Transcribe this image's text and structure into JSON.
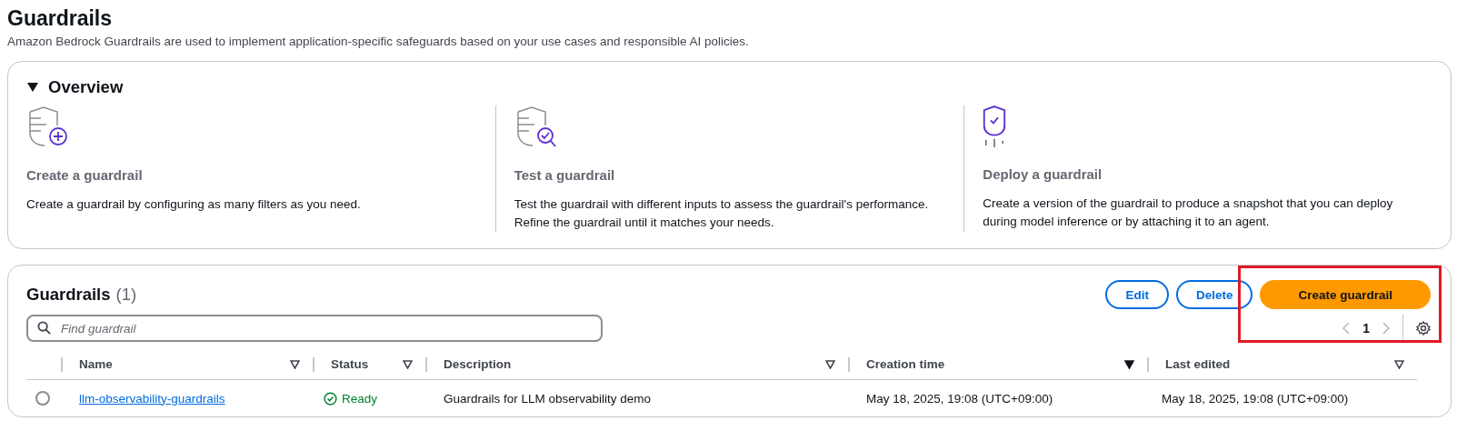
{
  "page": {
    "title": "Guardrails",
    "description": "Amazon Bedrock Guardrails are used to implement application-specific safeguards based on your use cases and responsible AI policies."
  },
  "overview": {
    "title": "Overview",
    "expanded": true,
    "steps": [
      {
        "kind": "create",
        "title": "Create a guardrail",
        "text": "Create a guardrail by configuring as many filters as you need."
      },
      {
        "kind": "test",
        "title": "Test a guardrail",
        "text": "Test the guardrail with different inputs to assess the guardrail's performance. Refine the guardrail until it matches your needs."
      },
      {
        "kind": "deploy",
        "title": "Deploy a guardrail",
        "text": "Create a version of the guardrail to produce a snapshot that you can deploy during model inference or by attaching it to an agent."
      }
    ]
  },
  "table": {
    "title": "Guardrails",
    "count": "(1)",
    "buttons": [
      {
        "label": "Edit",
        "kind": "normal",
        "highlighted": false
      },
      {
        "label": "Delete",
        "kind": "normal",
        "highlighted": false
      },
      {
        "label": "Create guardrail",
        "kind": "primary",
        "highlighted": true
      }
    ],
    "search": {
      "placeholder": "Find guardrail"
    },
    "pagination": {
      "page": "1"
    },
    "columns": [
      {
        "label": "Name",
        "sorted": false
      },
      {
        "label": "Status",
        "sorted": false
      },
      {
        "label": "Description",
        "sorted": false
      },
      {
        "label": "Creation time",
        "sorted": true
      },
      {
        "label": "Last edited",
        "sorted": false
      }
    ],
    "rows": [
      {
        "selected": false,
        "name": "llm-observability-guardrails",
        "status": "Ready",
        "description": "Guardrails for LLM observability demo",
        "creation_time": "May 18, 2025, 19:08 (UTC+09:00)",
        "last_edited": "May 18, 2025, 19:08 (UTC+09:00)"
      }
    ]
  }
}
